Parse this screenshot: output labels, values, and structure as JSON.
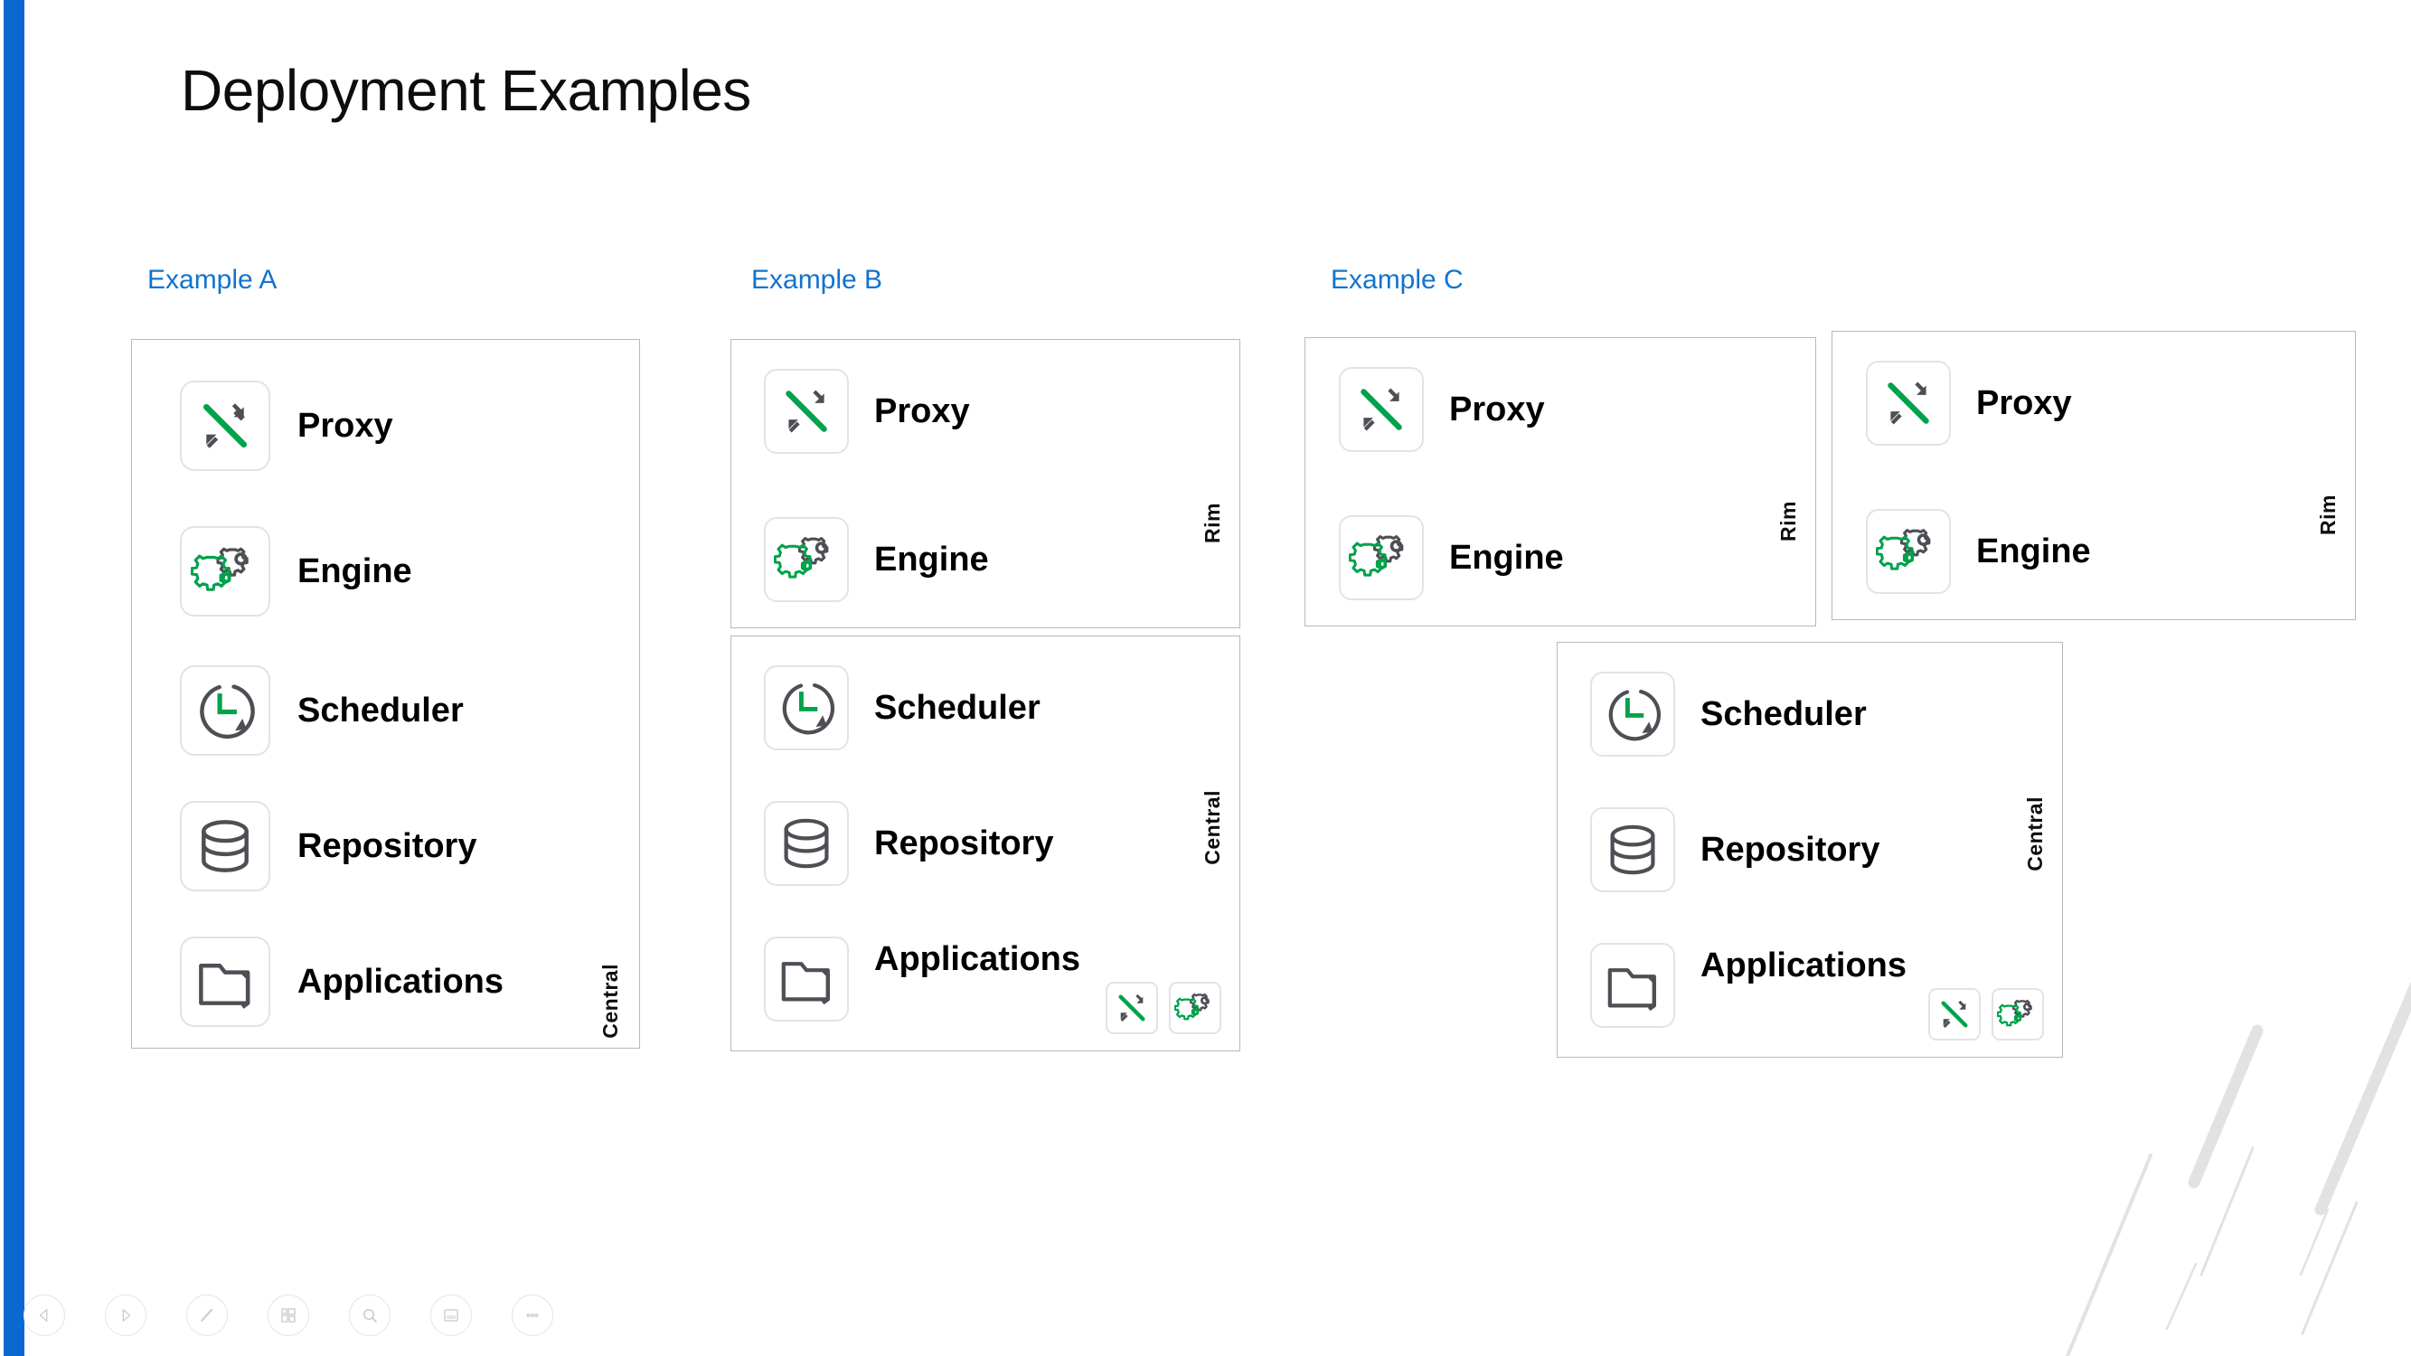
{
  "slide": {
    "title": "Deployment Examples",
    "accent_color": "#0a69ce",
    "label_color": "#1273ce",
    "green": "#00a24b",
    "gray": "#4d4f55"
  },
  "components": {
    "proxy": "Proxy",
    "engine": "Engine",
    "scheduler": "Scheduler",
    "repository": "Repository",
    "applications": "Applications"
  },
  "zones": {
    "central": "Central",
    "rim": "Rim"
  },
  "examples": [
    {
      "label": "Example A",
      "panels": [
        {
          "zone": "Central",
          "rows": [
            "Proxy",
            "Engine",
            "Scheduler",
            "Repository",
            "Applications"
          ],
          "mini_icons": []
        }
      ]
    },
    {
      "label": "Example B",
      "panels": [
        {
          "zone": "Rim",
          "rows": [
            "Proxy",
            "Engine"
          ],
          "mini_icons": []
        },
        {
          "zone": "Central",
          "rows": [
            "Scheduler",
            "Repository",
            "Applications"
          ],
          "mini_icons": [
            "proxy-icon",
            "engine-icon"
          ]
        }
      ]
    },
    {
      "label": "Example C",
      "panels": [
        {
          "zone": "Rim",
          "rows": [
            "Proxy",
            "Engine"
          ],
          "mini_icons": []
        },
        {
          "zone": "Rim",
          "rows": [
            "Proxy",
            "Engine"
          ],
          "mini_icons": []
        },
        {
          "zone": "Central",
          "rows": [
            "Scheduler",
            "Repository",
            "Applications"
          ],
          "mini_icons": [
            "proxy-icon",
            "engine-icon"
          ]
        }
      ]
    }
  ],
  "toolbar": {
    "buttons": [
      {
        "name": "previous-slide-button",
        "icon": "triangle-left-icon"
      },
      {
        "name": "play-slide-button",
        "icon": "triangle-right-icon"
      },
      {
        "name": "annotate-pen-button",
        "icon": "pen-icon"
      },
      {
        "name": "slide-overview-button",
        "icon": "grid-icon"
      },
      {
        "name": "zoom-search-button",
        "icon": "magnifier-icon"
      },
      {
        "name": "notes-button",
        "icon": "notes-icon"
      },
      {
        "name": "more-options-button",
        "icon": "ellipsis-icon"
      }
    ]
  }
}
